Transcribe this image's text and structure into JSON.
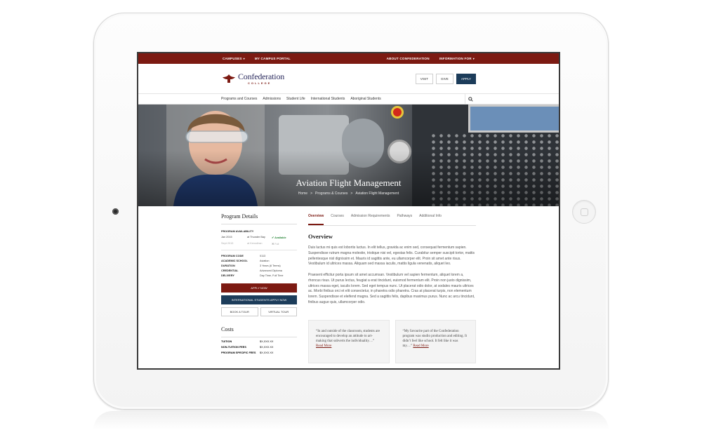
{
  "topbar": {
    "left": [
      {
        "label": "CAMPUSES",
        "caret": "▾"
      },
      {
        "label": "MY CAMPUS PORTAL",
        "caret": ""
      }
    ],
    "right": [
      {
        "label": "ABOUT CONFEDERATION",
        "caret": ""
      },
      {
        "label": "INFORMATION FOR",
        "caret": "▾"
      }
    ]
  },
  "header": {
    "logo_name": "Confederation",
    "logo_sub": "COLLEGE",
    "buttons": {
      "visit": "VISIT",
      "give": "GIVE",
      "apply": "APPLY"
    }
  },
  "nav": {
    "items": [
      "Programs and Courses",
      "Admissions",
      "Student Life",
      "International Students",
      "Aboriginal Students"
    ]
  },
  "hero": {
    "title": "Aviation Flight Management",
    "breadcrumb": [
      "Home",
      "Programs & Courses",
      "Aviation Flight Management"
    ],
    "separator": ">"
  },
  "sidebar": {
    "title": "Program Details",
    "availability_heading": "PROGRAM AVAILABILITY",
    "availability": [
      {
        "date": "Jan 2015",
        "location": "at Thunder Bay",
        "status": "✔ Available"
      },
      {
        "date": "Sept 2015",
        "location": "at Kenodhan",
        "status": "✖ Full"
      }
    ],
    "details": [
      {
        "key": "PROGRAM CODE",
        "value": "0113"
      },
      {
        "key": "ACADEMIC SCHOOL",
        "value": "Aviation"
      },
      {
        "key": "DURATION",
        "value": "3 Years (6 Terms)"
      },
      {
        "key": "CREDENTIAL",
        "value": "Advanced Diploma"
      },
      {
        "key": "DELIVERY",
        "value": "Day Time, Full Time"
      }
    ],
    "apply_now": "APPLY NOW",
    "intl_apply": "INTERNATIONAL STUDENTS APPLY NOW",
    "book_tour": "BOOK A TOUR",
    "virtual_tour": "VIRTUAL TOUR",
    "costs_title": "Costs",
    "costs": [
      {
        "key": "TUITION",
        "value": "$X,XXX.XX"
      },
      {
        "key": "NON-TUITION FEES",
        "value": "$X,XXX.XX"
      },
      {
        "key": "PROGRAM SPECIFIC FEES",
        "value": "$X,XXX.XX"
      }
    ]
  },
  "main": {
    "tabs": [
      "Overview",
      "Courses",
      "Admission Requirements",
      "Pathways",
      "Additional Info"
    ],
    "heading": "Overview",
    "paragraphs": [
      "Duis luctus mi quis est lobortis luctus. In elit tellus, gravida ac enim sed, consequat fermentum sapien. Suspendisse rutrum magna molestie, tristique nisi vel, egestas felis. Curabitur semper suscipit tortor, mattis pellentesque nisl dignissim et. Mauris id sagittis ante, eu ullamcorper elit. Proin sit amet ante risus. Vestibulum id ultrices massa. Aliquam sed massa iaculis, mattis ligula venenatis, aliquet leo.",
      "Praesent efficitur porta ipsum sit amet accumsan. Vestibulum vel sapien fermentum, aliquet lorem a, rhoncus risus. Ut purus lectus, feugiat a erat tincidunt, euismod fermentum elit. Proin non justo dignissim, ultrices massa eget, iaculis lorem. Sed eget tempus nunc. Ut placerat odio dolor, at sodales mauris ultrices ac. Morbi finibus orci et elit consectetur, in pharetra odio pharetra. Cras at placerat turpis, non elementum lorem. Suspendisse et eleifend magna. Sed a sagittis felis, dapibus maximus purus. Nunc ac arcu tincidunt, finibus augue quis, ullamcorper odio."
    ],
    "quotes": [
      {
        "text": "“In and outside of the classroom, students are encouraged to develop an attitude to art-making that subverts the individuality…”",
        "more": "Read More"
      },
      {
        "text": "“My favourite part of the Confederation program was studio production and editing. It didn’t feel like school. It felt like it was my…”",
        "more": "Read More"
      }
    ]
  },
  "colors": {
    "brand_red": "#7c1a12",
    "brand_blue": "#1c3c5a",
    "available_green": "#2f8a3f"
  }
}
